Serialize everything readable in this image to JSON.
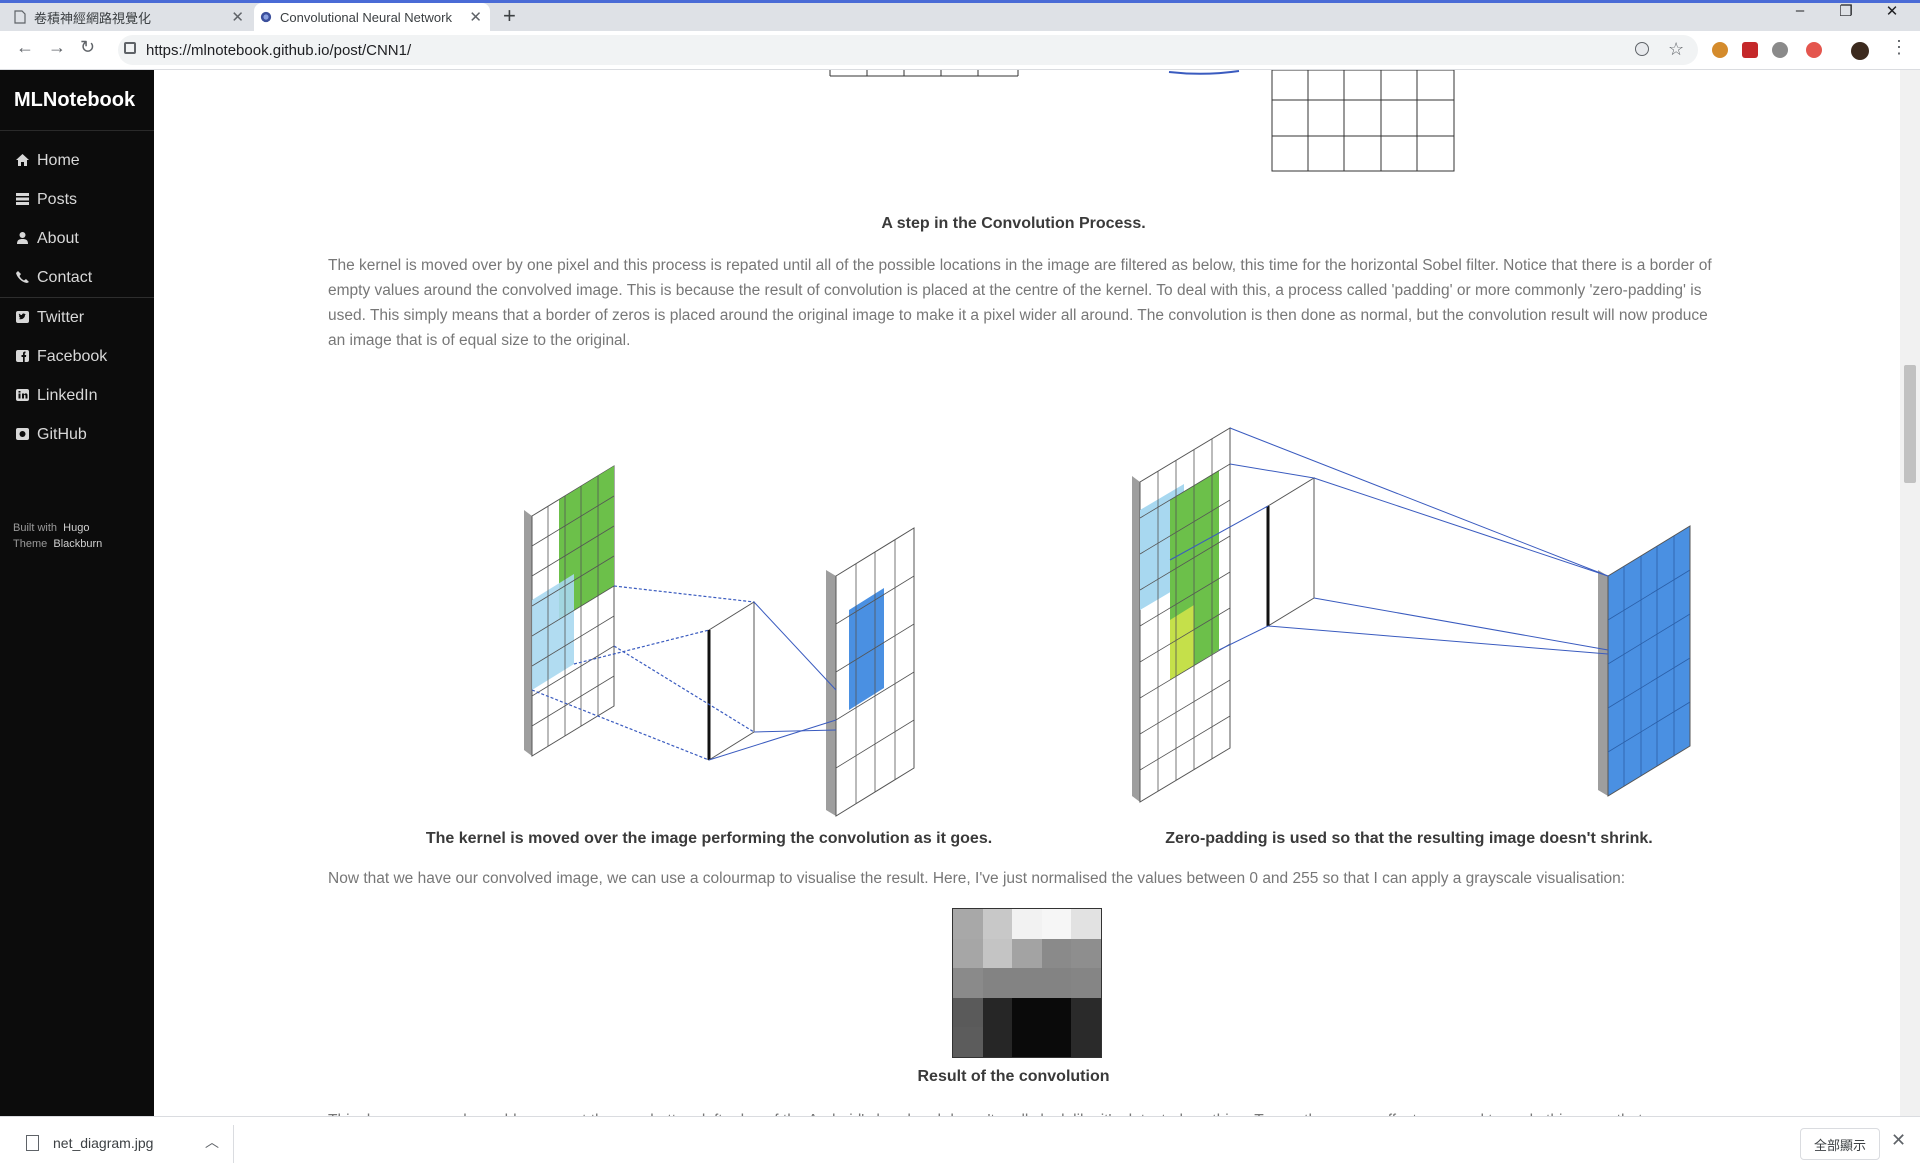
{
  "browser": {
    "tabs": [
      {
        "title": "卷積神經網路視覺化",
        "active": false
      },
      {
        "title": "Convolutional Neural Network",
        "active": true
      }
    ],
    "new_tab": "+",
    "url": "https://mlnotebook.github.io/post/CNN1/",
    "window_controls": {
      "minimize": "–",
      "restore": "❐",
      "close": "✕"
    }
  },
  "sidebar": {
    "brand": "MLNotebook",
    "items": [
      {
        "label": "Home",
        "icon": "home-icon"
      },
      {
        "label": "Posts",
        "icon": "list-icon"
      },
      {
        "label": "About",
        "icon": "user-icon"
      },
      {
        "label": "Contact",
        "icon": "phone-icon"
      },
      {
        "label": "Twitter",
        "icon": "twitter-icon"
      },
      {
        "label": "Facebook",
        "icon": "facebook-icon"
      },
      {
        "label": "LinkedIn",
        "icon": "linkedin-icon"
      },
      {
        "label": "GitHub",
        "icon": "github-icon"
      }
    ],
    "built_with": "Built with",
    "built_with_link": "Hugo",
    "theme": "Theme",
    "theme_link": "Blackburn"
  },
  "content": {
    "caption_step": "A step in the Convolution Process.",
    "paragraph1": "The kernel is moved over by one pixel and this process is repated until all of the possible locations in the image are filtered as below, this time for the horizontal Sobel filter. Notice that there is a border of empty values around the convolved image. This is because the result of convolution is placed at the centre of the kernel. To deal with this, a process called 'padding' or more commonly 'zero-padding' is used. This simply means that a border of zeros is placed around the original image to make it a pixel wider all around. The convolution is then done as normal, but the convolution result will now produce an image that is of equal size to the original.",
    "caption_kernel": "The kernel is moved over the image performing the convolution as it goes.",
    "caption_padding": "Zero-padding is used so that the resulting image doesn't shrink.",
    "paragraph2": "Now that we have our convolved image, we can use a colourmap to visualise the result. Here, I've just normalised the values between 0 and 255 so that I can apply a grayscale visualisation:",
    "caption_result": "Result of the convolution",
    "paragraph3": "This dummy example could represent the very bottom left edge of the Android's head and doesn't really look like it's detected anything. To see the proper effect, we need to scale this up so that",
    "result_grid": [
      [
        "#a8a8a8",
        "#c8c8c8",
        "#f2f2f2",
        "#f6f6f6",
        "#e2e2e2"
      ],
      [
        "#a6a6a6",
        "#c4c4c4",
        "#a3a3a3",
        "#8a8a8a",
        "#8e8e8e"
      ],
      [
        "#8a8a8a",
        "#838383",
        "#838383",
        "#838383",
        "#858585"
      ],
      [
        "#5a5a5a",
        "#262626",
        "#0a0a0a",
        "#0a0a0a",
        "#2a2a2a"
      ],
      [
        "#5c5c5c",
        "#262626",
        "#0a0a0a",
        "#0a0a0a",
        "#2a2a2a"
      ]
    ]
  },
  "download": {
    "file": "net_diagram.jpg",
    "show_all": "全部顯示",
    "close": "✕"
  }
}
